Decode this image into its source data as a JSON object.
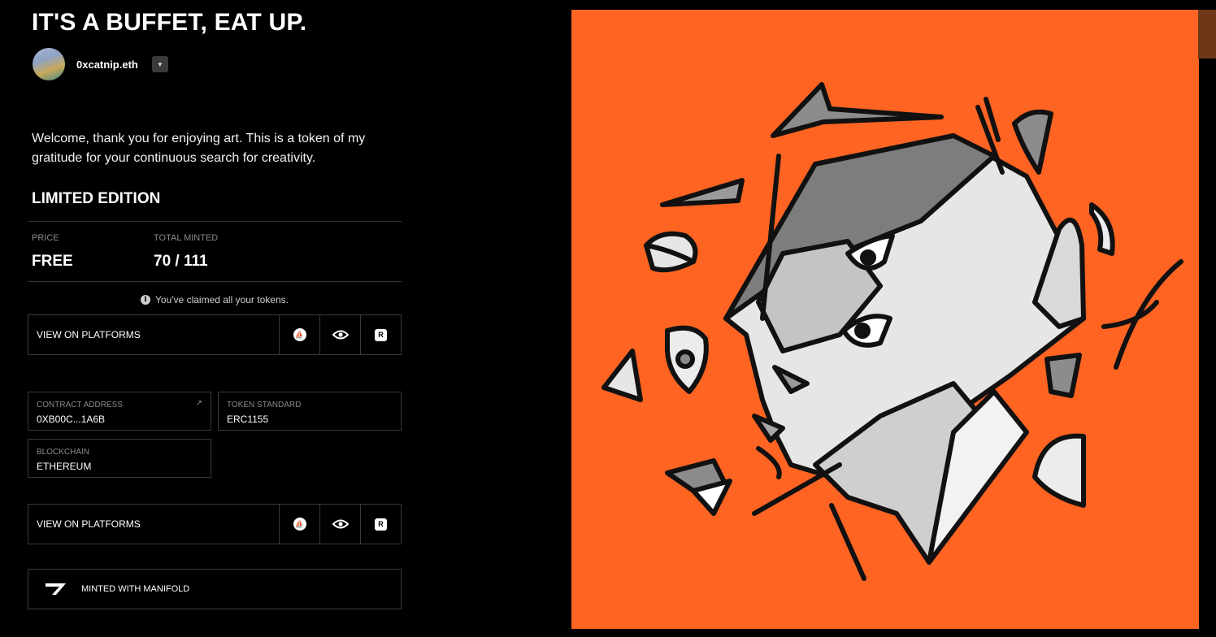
{
  "title": "IT'S A BUFFET, EAT UP.",
  "creator": {
    "name": "0xcatnip.eth"
  },
  "description": "Welcome, thank you for enjoying art. This is a token of my gratitude for your continuous search for creativity.",
  "edition": {
    "heading": "LIMITED EDITION",
    "price_label": "PRICE",
    "price_value": "FREE",
    "minted_label": "TOTAL MINTED",
    "minted_value": "70 / 111"
  },
  "claimed_notice": "You've claimed all your tokens.",
  "platforms": {
    "label": "VIEW ON PLATFORMS",
    "icons": [
      "opensea-icon",
      "eye-icon",
      "rarible-icon"
    ]
  },
  "details": {
    "contract_label": "CONTRACT ADDRESS",
    "contract_value": "0XB00C...1A6B",
    "standard_label": "TOKEN STANDARD",
    "standard_value": "ERC1155",
    "chain_label": "BLOCKCHAIN",
    "chain_value": "ETHEREUM"
  },
  "footer": {
    "text": "MINTED WITH MANIFOLD"
  },
  "colors": {
    "background": "#000000",
    "artwork_bg": "#ff6422",
    "border": "#3a3a3a"
  }
}
